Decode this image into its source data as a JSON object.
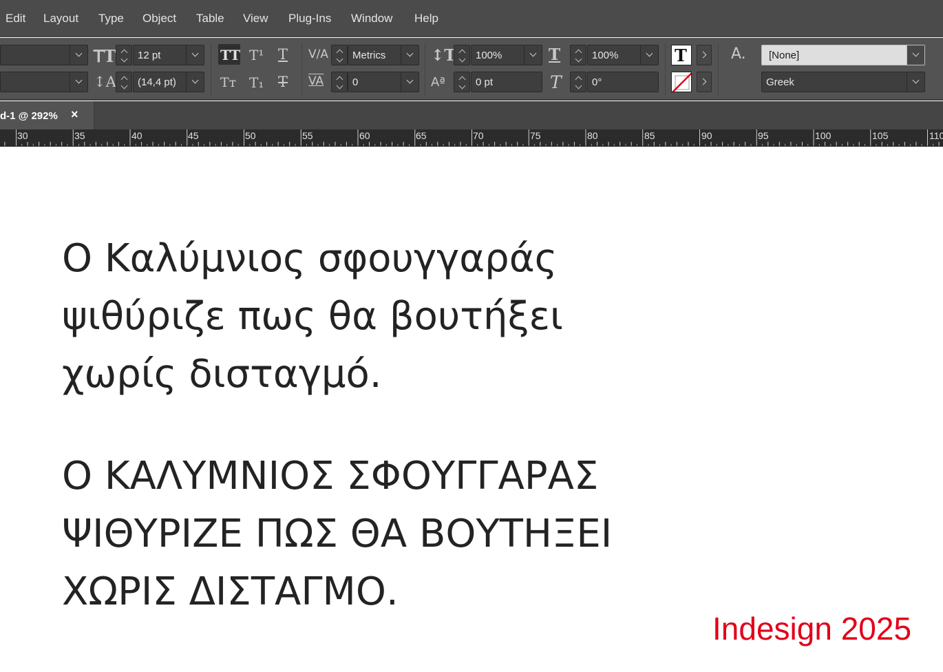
{
  "menu": [
    "Edit",
    "Layout",
    "Type",
    "Object",
    "Table",
    "View",
    "Plug-Ins",
    "Window",
    "Help"
  ],
  "control": {
    "font_size": "12 pt",
    "leading": "(14,4 pt)",
    "kerning": "Metrics",
    "tracking": "0",
    "vertical_scale": "100%",
    "horizontal_scale": "100%",
    "baseline_shift": "0 pt",
    "skew": "0°",
    "char_style": "[None]",
    "language": "Greek"
  },
  "icons": {
    "font_size": "font-size-icon",
    "leading": "leading-icon",
    "all_caps": "all-caps-icon",
    "superscript": "superscript-icon",
    "underline": "underline-icon",
    "small_caps": "small-caps-icon",
    "subscript": "subscript-icon",
    "strikethrough": "strikethrough-icon",
    "kerning": "kerning-icon",
    "tracking": "tracking-icon",
    "vertical_scale": "vertical-scale-icon",
    "horizontal_scale": "horizontal-scale-icon",
    "baseline_shift": "baseline-shift-icon",
    "skew": "skew-icon",
    "fill": "text-fill-icon",
    "stroke": "stroke-none-icon",
    "char_style": "character-style-icon"
  },
  "tab": {
    "title": "d-1 @ 292%",
    "close": "×"
  },
  "ruler": [
    "30",
    "35",
    "40",
    "45",
    "50",
    "55",
    "60",
    "65",
    "70",
    "75",
    "80",
    "85",
    "90",
    "95",
    "100",
    "105",
    "110"
  ],
  "document": {
    "paragraph1": [
      "Ο Καλύμνιος σφουγγαράς",
      "ψιθύριζε πως θα βουτήξει",
      "χωρίς δισταγμό."
    ],
    "paragraph2": [
      "Ο ΚΑΛΥΜΝΙΟΣ ΣΦΟΥΓΓΑΡΑΣ",
      "ΨΙΘΥΡΙΖΕ ΠΩΣ ΘΑ ΒΟΥΤΗΞΕΙ",
      "ΧΩΡΙΣ ΔΙΣΤΑΓΜΟ."
    ]
  },
  "watermark": "Indesign 2025",
  "colors": {
    "menu_bg": "#4b4b4b",
    "panel_bg": "#535353",
    "ruler_bg": "#2b2b2b",
    "text": "#232323",
    "watermark": "#e1001a"
  }
}
